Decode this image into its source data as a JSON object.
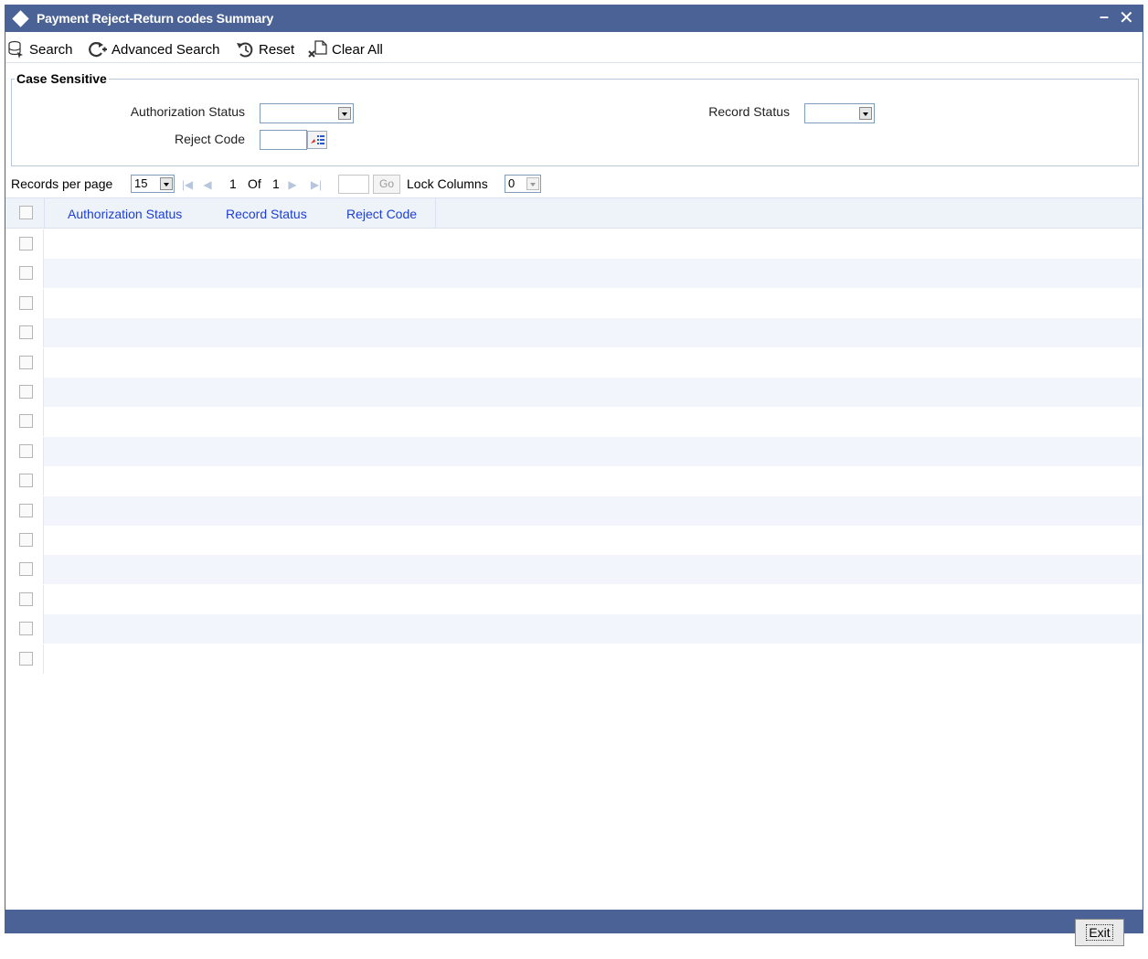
{
  "window": {
    "title": "Payment Reject-Return codes Summary",
    "minimize": "–",
    "close": "✕"
  },
  "toolbar": {
    "search": "Search",
    "advanced_search": "Advanced Search",
    "reset": "Reset",
    "clear_all": "Clear All"
  },
  "criteria": {
    "legend": "Case Sensitive",
    "authorization_status_label": "Authorization Status",
    "authorization_status_value": "",
    "record_status_label": "Record Status",
    "record_status_value": "",
    "reject_code_label": "Reject Code",
    "reject_code_value": ""
  },
  "pager": {
    "records_per_page_label": "Records per page",
    "records_per_page": "15",
    "current_page": "1",
    "of_label": "Of",
    "total_pages": "1",
    "go_label": "Go",
    "lock_columns_label": "Lock Columns",
    "lock_columns": "0"
  },
  "grid": {
    "columns": [
      "Authorization Status",
      "Record Status",
      "Reject Code"
    ],
    "row_count": 15
  },
  "footer": {
    "exit": "Exit"
  },
  "colors": {
    "title_bar": "#4a6296",
    "column_header_text": "#1e3fd6",
    "alt_row": "#f2f5fb"
  }
}
